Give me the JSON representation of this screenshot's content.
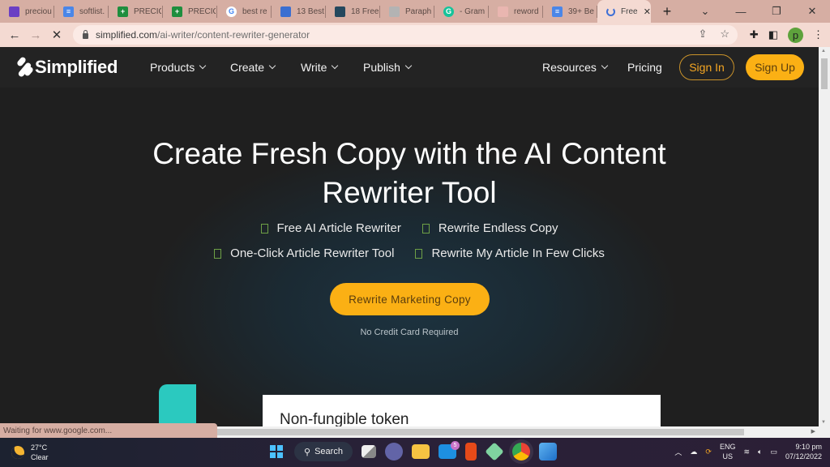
{
  "browser": {
    "tabs": [
      {
        "title": "preciou",
        "icon": "mail-icon",
        "color": "#6b3fc4"
      },
      {
        "title": "softlist.",
        "icon": "docs-icon",
        "color": "#4a86e8"
      },
      {
        "title": "PRECIO",
        "icon": "sheets-icon",
        "color": "#1e8e3e"
      },
      {
        "title": "PRECIO",
        "icon": "sheets-icon",
        "color": "#1e8e3e"
      },
      {
        "title": "best re",
        "icon": "google-icon",
        "color": "#ffffff"
      },
      {
        "title": "13 Best",
        "icon": "chart-icon",
        "color": "#3b6fd1"
      },
      {
        "title": "18 Free",
        "icon": "image-icon",
        "color": "#24485e"
      },
      {
        "title": "Paraph",
        "icon": "quill-icon",
        "color": "#b3b3b3"
      },
      {
        "title": "- Gram",
        "icon": "grammarly-icon",
        "color": "#15c39a"
      },
      {
        "title": "reword",
        "icon": "reword-icon",
        "color": "#e9b6b0"
      },
      {
        "title": "39+ Be",
        "icon": "docs-icon",
        "color": "#4a86e8"
      },
      {
        "title": "Free",
        "icon": "loading-icon",
        "active": true
      }
    ],
    "new_tab": "+",
    "window_controls": {
      "tab_search": "⌄",
      "minimize": "—",
      "restore": "❐",
      "close": "✕"
    },
    "nav": {
      "back": "←",
      "forward": "→",
      "stop": "✕"
    },
    "url": {
      "domain": "simplified.com",
      "path": "/ai-writer/content-rewriter-generator"
    },
    "profile_initial": "p",
    "status_text": "Waiting for www.google.com..."
  },
  "site": {
    "brand": "Simplified",
    "nav": [
      {
        "label": "Products",
        "dropdown": true
      },
      {
        "label": "Create",
        "dropdown": true
      },
      {
        "label": "Write",
        "dropdown": true
      },
      {
        "label": "Publish",
        "dropdown": true
      },
      {
        "label": "Resources",
        "dropdown": true
      },
      {
        "label": "Pricing",
        "dropdown": false
      }
    ],
    "sign_in": "Sign In",
    "sign_up": "Sign Up",
    "hero": {
      "title_line1": "Create Fresh Copy with the AI Content",
      "title_line2": "Rewriter Tool",
      "features_row1": [
        "Free AI Article Rewriter",
        "Rewrite Endless Copy"
      ],
      "features_row2": [
        "One-Click Article Rewriter Tool",
        "Rewrite My Article In Few Clicks"
      ],
      "cta": "Rewrite Marketing Copy",
      "cta_note": "No Credit Card Required"
    },
    "preview_card_title": "Non-fungible token",
    "accent_color": "#fbb014"
  },
  "taskbar": {
    "weather": {
      "temp": "27°C",
      "condition": "Clear"
    },
    "search_label": "Search",
    "mail_badge": "5",
    "language": {
      "line1": "ENG",
      "line2": "US"
    },
    "time": "9:10 pm",
    "date": "07/12/2022"
  }
}
